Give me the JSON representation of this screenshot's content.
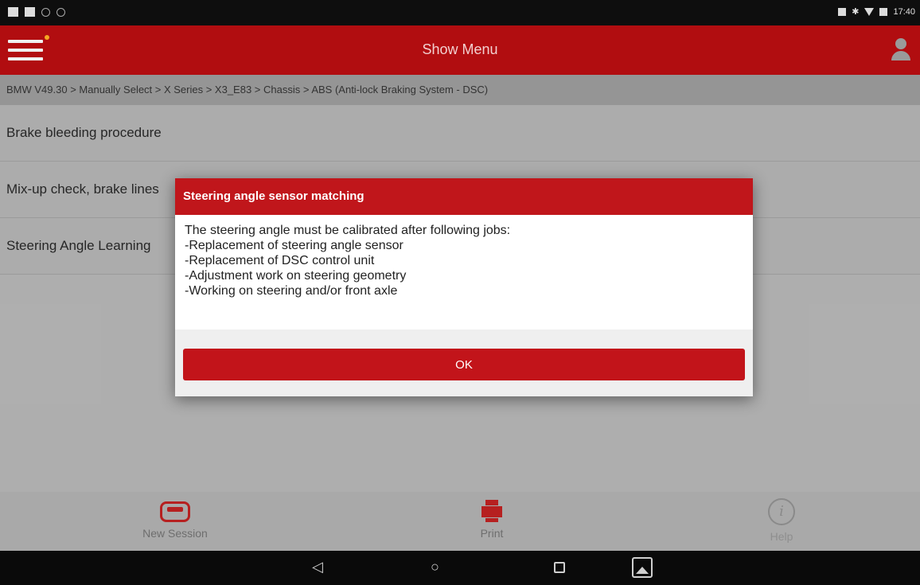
{
  "status_bar": {
    "time": "17:40"
  },
  "header": {
    "title": "Show Menu"
  },
  "breadcrumb": "BMW V49.30 > Manually Select > X Series > X3_E83 > Chassis > ABS (Anti-lock Braking System - DSC)",
  "menu_items": [
    {
      "label": "Brake bleeding procedure"
    },
    {
      "label": "Mix-up check, brake lines"
    },
    {
      "label": "Steering Angle Learning"
    }
  ],
  "dialog": {
    "title": "Steering angle sensor matching",
    "lines": [
      "The steering angle must be calibrated after following jobs:",
      "-Replacement of steering angle sensor",
      "-Replacement of DSC control unit",
      "-Adjustment work on steering geometry",
      "-Working on steering and/or front axle"
    ],
    "ok_label": "OK"
  },
  "toolbar": {
    "new_session": "New Session",
    "print": "Print",
    "help": "Help"
  },
  "nav": {
    "back": "◁",
    "home": "○"
  },
  "colors": {
    "brand_red": "#b10d10",
    "dialog_red": "#c0161b",
    "toolbar_gray": "#a9a9a9"
  },
  "icons": {
    "menu": "hamburger-icon",
    "user": "user-icon",
    "new_session": "car-icon",
    "print": "printer-icon",
    "help": "info-icon"
  }
}
